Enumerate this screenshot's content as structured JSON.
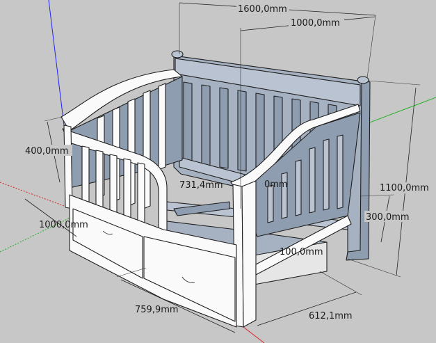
{
  "scene": {
    "axis_colors": {
      "blue": "#2020ff",
      "red": "#e02020",
      "green": "#20b020"
    },
    "model_colors": {
      "front_face": "#fafafa",
      "back_face": "#a6b2c2",
      "background": "#c7c7c7"
    }
  },
  "dimensions": {
    "total_width": "1600,0mm",
    "back_width": "1000,0mm",
    "arm_height": "400,0mm",
    "side_depth": "1000,0mm",
    "total_height": "1100,0mm",
    "seat_height": "300,0mm",
    "inner_span": "731,4mm",
    "inner_small": "0mm",
    "drawer_height": "100,0mm",
    "drawer_width": "759,9mm",
    "drawer_depth": "612,1mm"
  }
}
